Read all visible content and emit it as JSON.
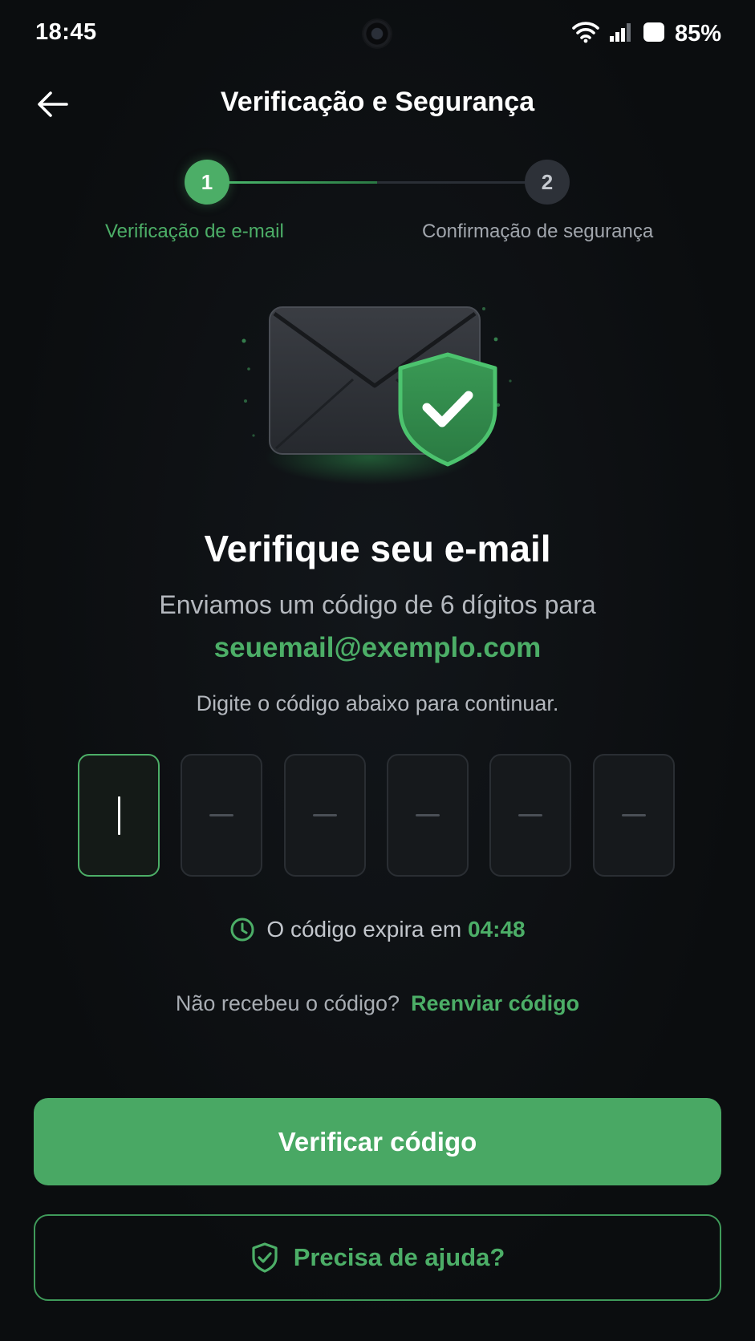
{
  "status_bar": {
    "time": "18:45",
    "battery": "85%",
    "icons": [
      "wifi-icon",
      "signal-icon",
      "battery-icon"
    ]
  },
  "header": {
    "title": "Verificação e Segurança",
    "back_icon": "arrow-left-icon"
  },
  "stepper": {
    "steps": [
      {
        "number": "1",
        "label": "Verificação de e-mail",
        "state": "active"
      },
      {
        "number": "2",
        "label": "Confirmação de segurança",
        "state": "inactive"
      }
    ],
    "progress_fraction": 0.5
  },
  "illustration": {
    "icons": [
      "envelope-icon",
      "shield-check-icon"
    ]
  },
  "content": {
    "headline": "Verifique seu e-mail",
    "subtitle": "Enviamos um código de 6 dígitos para",
    "email": "seuemail@exemplo.com",
    "hint": "Digite o código abaixo para continuar."
  },
  "otp": {
    "length": 6,
    "values": [
      "",
      "",
      "",
      "",
      "",
      ""
    ],
    "active_index": 0
  },
  "timer": {
    "label": "O código expira em",
    "countdown": "04:48",
    "icon": "clock-icon"
  },
  "resend": {
    "prompt": "Não recebeu o código?",
    "link": "Reenviar código"
  },
  "actions": {
    "verify_label": "Verificar código",
    "help_label": "Precisa de ajuda?",
    "help_icon": "shield-check-icon"
  },
  "colors": {
    "background": "#0c0e10",
    "accent": "#4cae67",
    "text_primary": "#ffffff",
    "text_secondary": "#b4b8be",
    "box_bg": "#16191c",
    "box_border": "#2a2e33"
  }
}
